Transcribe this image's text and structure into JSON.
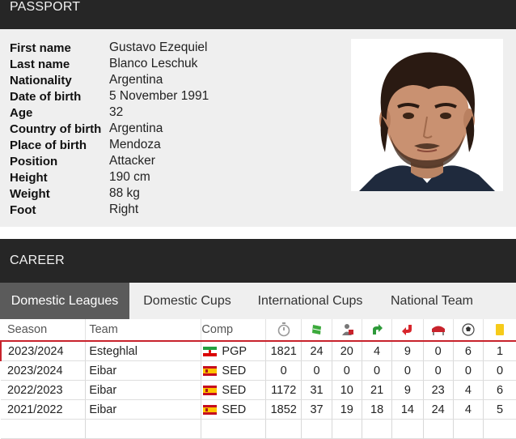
{
  "passport": {
    "header": "PASSPORT",
    "fields": [
      {
        "label": "First name",
        "value": "Gustavo Ezequiel"
      },
      {
        "label": "Last name",
        "value": "Blanco Leschuk"
      },
      {
        "label": "Nationality",
        "value": "Argentina"
      },
      {
        "label": "Date of birth",
        "value": "5 November 1991"
      },
      {
        "label": "Age",
        "value": "32"
      },
      {
        "label": "Country of birth",
        "value": "Argentina"
      },
      {
        "label": "Place of birth",
        "value": "Mendoza"
      },
      {
        "label": "Position",
        "value": "Attacker"
      },
      {
        "label": "Height",
        "value": "190 cm"
      },
      {
        "label": "Weight",
        "value": "88 kg"
      },
      {
        "label": "Foot",
        "value": "Right"
      }
    ]
  },
  "career": {
    "header": "CAREER",
    "tabs": [
      "Domestic Leagues",
      "Domestic Cups",
      "International Cups",
      "National Team"
    ],
    "active_tab": "Domestic Leagues",
    "columns": {
      "season": "Season",
      "team": "Team",
      "comp": "Comp",
      "stat_icons": [
        "stopwatch-icon",
        "field-icon",
        "substitution-player-icon",
        "sub-in-arrow-icon",
        "sub-out-arrow-icon",
        "bench-icon",
        "ball-icon",
        "yellow-card-icon"
      ]
    },
    "rows": [
      {
        "season": "2023/2024",
        "team": "Esteghlal",
        "flag": "iran",
        "comp": "PGP",
        "stats": [
          "1821",
          "24",
          "20",
          "4",
          "9",
          "0",
          "6",
          "1"
        ],
        "highlighted": true
      },
      {
        "season": "2023/2024",
        "team": "Eibar",
        "flag": "spain",
        "comp": "SED",
        "stats": [
          "0",
          "0",
          "0",
          "0",
          "0",
          "0",
          "0",
          "0"
        ],
        "highlighted": false
      },
      {
        "season": "2022/2023",
        "team": "Eibar",
        "flag": "spain",
        "comp": "SED",
        "stats": [
          "1172",
          "31",
          "10",
          "21",
          "9",
          "23",
          "4",
          "6"
        ],
        "highlighted": false
      },
      {
        "season": "2021/2022",
        "team": "Eibar",
        "flag": "spain",
        "comp": "SED",
        "stats": [
          "1852",
          "37",
          "19",
          "18",
          "14",
          "24",
          "4",
          "5"
        ],
        "highlighted": false
      }
    ]
  },
  "colors": {
    "header_bg": "#262626",
    "panel_bg": "#efefef",
    "active_tab_bg": "#5b5b5b",
    "highlight_border": "#c8232c"
  }
}
